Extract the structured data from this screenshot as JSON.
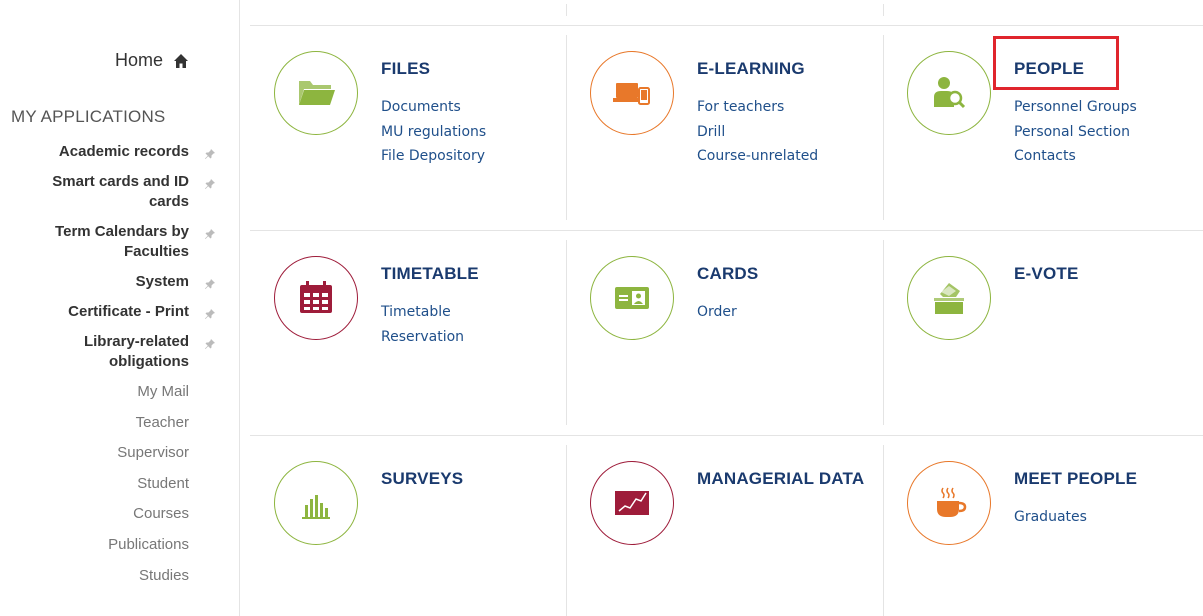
{
  "sidebar": {
    "home_label": "Home",
    "section_title": "MY APPLICATIONS",
    "pinned_apps": [
      {
        "label": "Academic records",
        "lines": [
          "Academic records"
        ]
      },
      {
        "label": "Smart cards and ID cards",
        "lines": [
          "Smart cards and ID",
          "cards"
        ]
      },
      {
        "label": "Term Calendars by Faculties",
        "lines": [
          "Term Calendars by",
          "Faculties"
        ]
      },
      {
        "label": "System",
        "lines": [
          "System"
        ]
      },
      {
        "label": "Certificate - Print",
        "lines": [
          "Certificate - Print"
        ]
      },
      {
        "label": "Library-related obligations",
        "lines": [
          "Library-related",
          "obligations"
        ]
      }
    ],
    "other_apps": [
      "My Mail",
      "Teacher",
      "Supervisor",
      "Student",
      "Courses",
      "Publications",
      "Studies"
    ]
  },
  "tiles": [
    {
      "id": "files",
      "title": "FILES",
      "icon": "folder-icon",
      "color": "#8db53f",
      "links": [
        "Documents",
        "MU regulations",
        "File Depository"
      ]
    },
    {
      "id": "e-learning",
      "title": "E-LEARNING",
      "icon": "devices-icon",
      "color": "#e8782a",
      "links": [
        "For teachers",
        "Drill",
        "Course-unrelated"
      ]
    },
    {
      "id": "people",
      "title": "PEOPLE",
      "icon": "person-search-icon",
      "color": "#8db53f",
      "links": [
        "Personnel Groups",
        "Personal Section",
        "Contacts"
      ]
    },
    {
      "id": "timetable",
      "title": "TIMETABLE",
      "icon": "calendar-icon",
      "color": "#9e1c3a",
      "links": [
        "Timetable",
        "Reservation"
      ]
    },
    {
      "id": "cards",
      "title": "CARDS",
      "icon": "id-card-icon",
      "color": "#8db53f",
      "links": [
        "Order"
      ]
    },
    {
      "id": "e-vote",
      "title": "E-VOTE",
      "icon": "ballot-box-icon",
      "color": "#8db53f",
      "links": []
    },
    {
      "id": "surveys",
      "title": "SURVEYS",
      "icon": "bar-chart-icon",
      "color": "#8db53f",
      "links": []
    },
    {
      "id": "managerial-data",
      "title": "MANAGERIAL DATA",
      "icon": "line-chart-icon",
      "color": "#9e1c3a",
      "links": []
    },
    {
      "id": "meet-people",
      "title": "MEET PEOPLE",
      "icon": "coffee-cup-icon",
      "color": "#e8782a",
      "links": [
        "Graduates"
      ]
    }
  ],
  "highlighted_tile": "people"
}
